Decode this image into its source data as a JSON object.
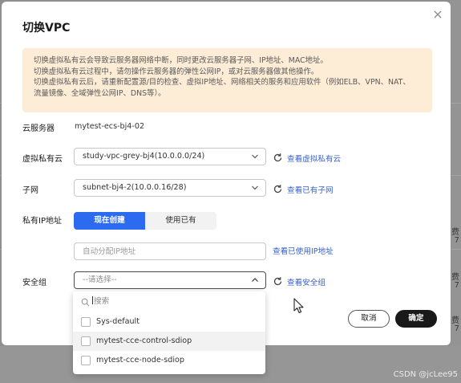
{
  "dialog": {
    "title": "切换VPC",
    "alert_lines": [
      "切换虚拟私有云会导致云服务器网络中断，同时更改云服务器子网、IP地址、MAC地址。",
      "切换虚拟私有云过程中，请勿操作云服务器的弹性公网IP，或对云服务器做其他操作。",
      "切换虚拟私有云后，请重新配置源/目的检查、虚拟IP地址、网络相关的服务和应用软件（例如ELB、VPN、NAT、",
      "流量镜像、全域弹性公网IP、DNS等）。"
    ]
  },
  "form": {
    "server_label": "云服务器",
    "server_value": "mytest-ecs-bj4-02",
    "vpc_label": "虚拟私有云",
    "vpc_value": "study-vpc-grey-bj4(10.0.0.0/24)",
    "vpc_link": "查看虚拟私有云",
    "subnet_label": "子网",
    "subnet_value": "subnet-bj4-2(10.0.0.16/28)",
    "subnet_link": "查看已有子网",
    "ip_label": "私有IP地址",
    "ip_mode_new": "现在创建",
    "ip_mode_existing": "使用已有",
    "ip_placeholder": "自动分配IP地址",
    "ip_link": "查看已使用IP地址",
    "sg_label": "安全组",
    "sg_placeholder": "--请选择--",
    "sg_link": "查看安全组"
  },
  "dropdown": {
    "search_placeholder": "搜索",
    "options": [
      "Sys-default",
      "mytest-cce-control-sdiop",
      "mytest-cce-node-sdiop"
    ]
  },
  "footer": {
    "cancel": "取消",
    "confirm": "确定"
  },
  "background": {
    "fragments": [
      "费",
      "7",
      "费",
      "7",
      "费",
      "7"
    ],
    "watermark": "CSDN @jcLee95"
  },
  "colors": {
    "primary": "#2c6bf0",
    "link": "#3a62c9",
    "alert_bg": "#fdecd6",
    "dark_button": "#191919"
  }
}
